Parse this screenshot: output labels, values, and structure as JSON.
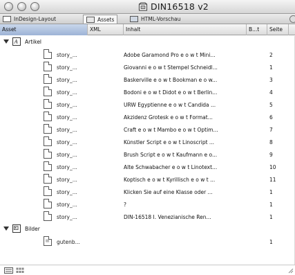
{
  "window": {
    "title": "DIN16518 v2"
  },
  "tabs": [
    {
      "label": "InDesign-Layout",
      "icon": "layout-icon"
    },
    {
      "label": "Assets",
      "icon": "assets-icon",
      "active": true
    },
    {
      "label": "HTML-Vorschau",
      "icon": "html-preview-icon"
    }
  ],
  "columns": {
    "asset": "Asset",
    "xml": "XML",
    "inhalt": "Inhalt",
    "bt": "B...t",
    "seite": "Seite"
  },
  "groups": [
    {
      "label": "Artikel",
      "icon": "article-group-icon",
      "items": [
        {
          "name": "story_...",
          "content": "Adobe Garamond Pro e o w t Mini...",
          "page": "2"
        },
        {
          "name": "story_...",
          "content": "Giovanni e o w t Stempel Schneidl...",
          "page": "1"
        },
        {
          "name": "story_...",
          "content": "Baskerville e o w t Bookman e o w...",
          "page": "3"
        },
        {
          "name": "story_...",
          "content": "Bodoni e o w t Didot e o w t Berlin...",
          "page": "4"
        },
        {
          "name": "story_...",
          "content": "URW Egyptienne e o w t Candida ...",
          "page": "5"
        },
        {
          "name": "story_...",
          "content": "Akzidenz Grotesk e o w t Format...",
          "page": "6"
        },
        {
          "name": "story_...",
          "content": "Craft e o w t Mambo e o w t Optim...",
          "page": "7"
        },
        {
          "name": "story_...",
          "content": "Künstler Script e o w t Linoscript ...",
          "page": "8"
        },
        {
          "name": "story_...",
          "content": "Brush Script e o w t Kaufmann e o...",
          "page": "9"
        },
        {
          "name": "story_...",
          "content": "Alte Schwabacher e o w t Linotext...",
          "page": "10"
        },
        {
          "name": "story_...",
          "content": "Koptisch e o w t Kyrillisch e o w t ...",
          "page": "11"
        },
        {
          "name": "story_...",
          "content": "Klicken Sie auf eine Klasse oder ...",
          "page": "1"
        },
        {
          "name": "story_...",
          "content": "?",
          "page": "1"
        },
        {
          "name": "story_...",
          "content": "DIN-16518 I. Venezianische Ren...",
          "page": "1"
        }
      ]
    },
    {
      "label": "Bilder",
      "icon": "images-group-icon",
      "items": [
        {
          "name": "gutenb...",
          "content": "",
          "page": "1"
        }
      ]
    }
  ],
  "footer": {
    "left_icons": [
      "list-view-icon",
      "thumbnail-view-icon"
    ]
  }
}
